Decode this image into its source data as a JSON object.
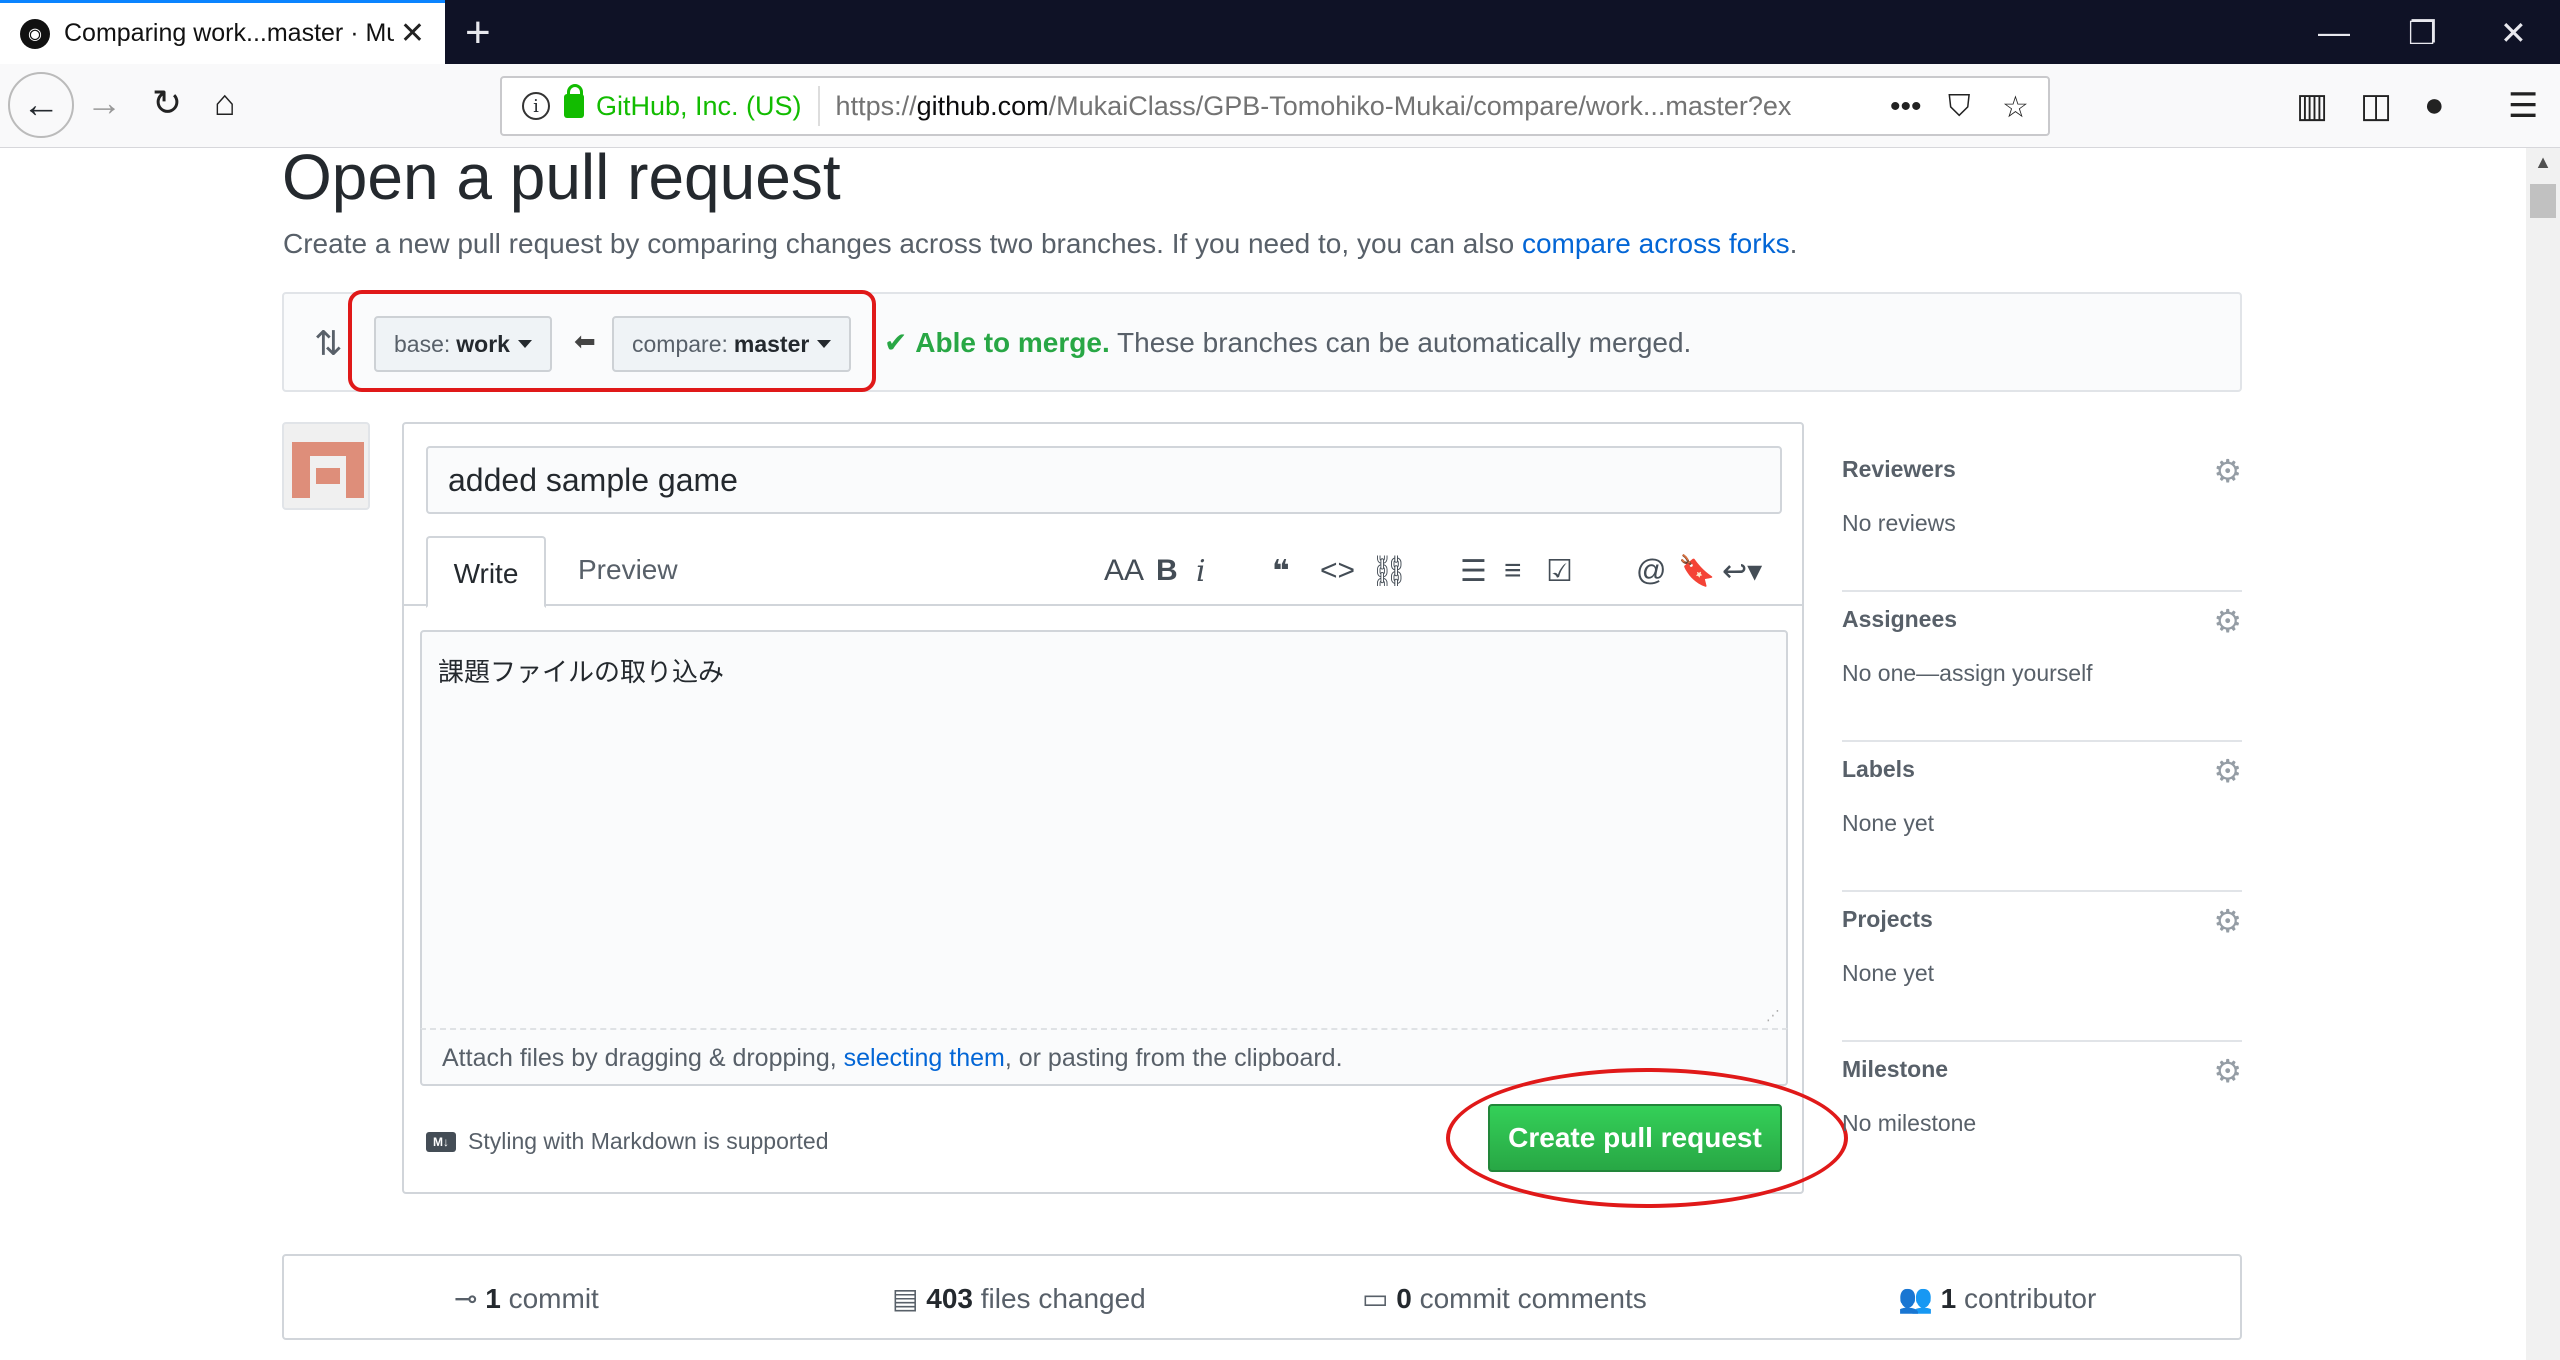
{
  "browser": {
    "tab_title": "Comparing work...master · Muk",
    "tab_close": "✕",
    "new_tab": "+",
    "identity_org": "GitHub, Inc. (US)",
    "url_prefix": "https://",
    "url_host": "github.com",
    "url_path": "/MukaiClass/GPB-Tomohiko-Mukai/compare/work...master?ex",
    "win_min": "—",
    "win_restore": "❐",
    "win_close": "✕",
    "page_actions": "•••"
  },
  "page": {
    "title": "Open a pull request",
    "subtitle": "Create a new pull request by comparing changes across two branches. If you need to, you can also",
    "subtitle_link": "compare across forks",
    "subtitle_end": "."
  },
  "range": {
    "base_prefix": "base:",
    "base_branch": "work",
    "compare_prefix": "compare:",
    "compare_branch": "master",
    "status_ok": "Able to merge.",
    "status_text": "These branches can be automatically merged."
  },
  "form": {
    "title_value": "added sample game",
    "tab_write": "Write",
    "tab_preview": "Preview",
    "body_value": "課題ファイルの取り込み",
    "attach_text_1": "Attach files by dragging & dropping,",
    "attach_link": "selecting them",
    "attach_text_2": ", or pasting from the clipboard.",
    "markdown_note": "Styling with Markdown is supported",
    "markdown_icon": "M↓",
    "submit_label": "Create pull request"
  },
  "sidebar": {
    "items": [
      {
        "label": "Reviewers",
        "value": "No reviews"
      },
      {
        "label": "Assignees",
        "value": "No one—assign yourself"
      },
      {
        "label": "Labels",
        "value": "None yet"
      },
      {
        "label": "Projects",
        "value": "None yet"
      },
      {
        "label": "Milestone",
        "value": "No milestone"
      }
    ]
  },
  "stats": {
    "commits_count": "1",
    "commits_label": "commit",
    "files_count": "403",
    "files_label": "files changed",
    "comments_count": "0",
    "comments_label": "commit comments",
    "contributors_count": "1",
    "contributors_label": "contributor"
  },
  "colors": {
    "accent_link": "#0366d6",
    "merge_ok": "#28a745",
    "annotation_red": "#e01919"
  }
}
